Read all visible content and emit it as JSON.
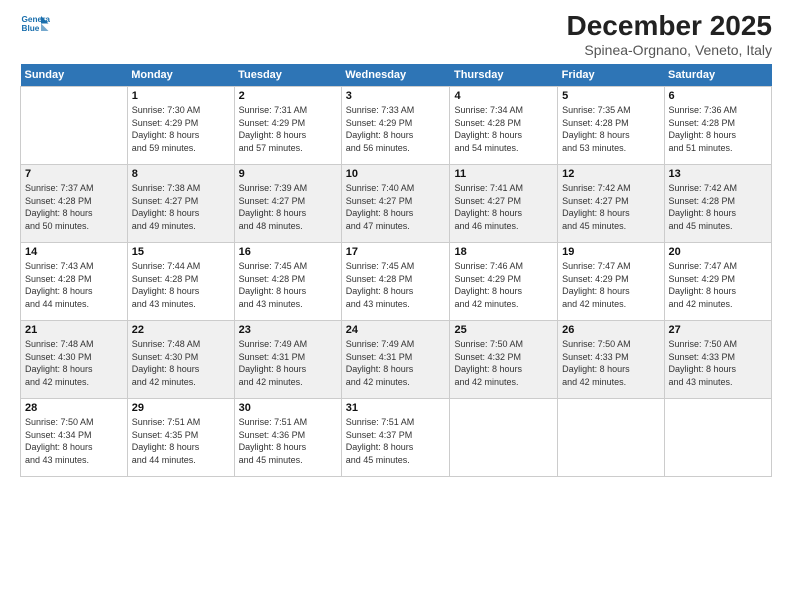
{
  "header": {
    "logo_line1": "General",
    "logo_line2": "Blue",
    "month": "December 2025",
    "location": "Spinea-Orgnano, Veneto, Italy"
  },
  "weekdays": [
    "Sunday",
    "Monday",
    "Tuesday",
    "Wednesday",
    "Thursday",
    "Friday",
    "Saturday"
  ],
  "weeks": [
    [
      {
        "day": "",
        "info": ""
      },
      {
        "day": "1",
        "info": "Sunrise: 7:30 AM\nSunset: 4:29 PM\nDaylight: 8 hours\nand 59 minutes."
      },
      {
        "day": "2",
        "info": "Sunrise: 7:31 AM\nSunset: 4:29 PM\nDaylight: 8 hours\nand 57 minutes."
      },
      {
        "day": "3",
        "info": "Sunrise: 7:33 AM\nSunset: 4:29 PM\nDaylight: 8 hours\nand 56 minutes."
      },
      {
        "day": "4",
        "info": "Sunrise: 7:34 AM\nSunset: 4:28 PM\nDaylight: 8 hours\nand 54 minutes."
      },
      {
        "day": "5",
        "info": "Sunrise: 7:35 AM\nSunset: 4:28 PM\nDaylight: 8 hours\nand 53 minutes."
      },
      {
        "day": "6",
        "info": "Sunrise: 7:36 AM\nSunset: 4:28 PM\nDaylight: 8 hours\nand 51 minutes."
      }
    ],
    [
      {
        "day": "7",
        "info": "Sunrise: 7:37 AM\nSunset: 4:28 PM\nDaylight: 8 hours\nand 50 minutes."
      },
      {
        "day": "8",
        "info": "Sunrise: 7:38 AM\nSunset: 4:27 PM\nDaylight: 8 hours\nand 49 minutes."
      },
      {
        "day": "9",
        "info": "Sunrise: 7:39 AM\nSunset: 4:27 PM\nDaylight: 8 hours\nand 48 minutes."
      },
      {
        "day": "10",
        "info": "Sunrise: 7:40 AM\nSunset: 4:27 PM\nDaylight: 8 hours\nand 47 minutes."
      },
      {
        "day": "11",
        "info": "Sunrise: 7:41 AM\nSunset: 4:27 PM\nDaylight: 8 hours\nand 46 minutes."
      },
      {
        "day": "12",
        "info": "Sunrise: 7:42 AM\nSunset: 4:27 PM\nDaylight: 8 hours\nand 45 minutes."
      },
      {
        "day": "13",
        "info": "Sunrise: 7:42 AM\nSunset: 4:28 PM\nDaylight: 8 hours\nand 45 minutes."
      }
    ],
    [
      {
        "day": "14",
        "info": "Sunrise: 7:43 AM\nSunset: 4:28 PM\nDaylight: 8 hours\nand 44 minutes."
      },
      {
        "day": "15",
        "info": "Sunrise: 7:44 AM\nSunset: 4:28 PM\nDaylight: 8 hours\nand 43 minutes."
      },
      {
        "day": "16",
        "info": "Sunrise: 7:45 AM\nSunset: 4:28 PM\nDaylight: 8 hours\nand 43 minutes."
      },
      {
        "day": "17",
        "info": "Sunrise: 7:45 AM\nSunset: 4:28 PM\nDaylight: 8 hours\nand 43 minutes."
      },
      {
        "day": "18",
        "info": "Sunrise: 7:46 AM\nSunset: 4:29 PM\nDaylight: 8 hours\nand 42 minutes."
      },
      {
        "day": "19",
        "info": "Sunrise: 7:47 AM\nSunset: 4:29 PM\nDaylight: 8 hours\nand 42 minutes."
      },
      {
        "day": "20",
        "info": "Sunrise: 7:47 AM\nSunset: 4:29 PM\nDaylight: 8 hours\nand 42 minutes."
      }
    ],
    [
      {
        "day": "21",
        "info": "Sunrise: 7:48 AM\nSunset: 4:30 PM\nDaylight: 8 hours\nand 42 minutes."
      },
      {
        "day": "22",
        "info": "Sunrise: 7:48 AM\nSunset: 4:30 PM\nDaylight: 8 hours\nand 42 minutes."
      },
      {
        "day": "23",
        "info": "Sunrise: 7:49 AM\nSunset: 4:31 PM\nDaylight: 8 hours\nand 42 minutes."
      },
      {
        "day": "24",
        "info": "Sunrise: 7:49 AM\nSunset: 4:31 PM\nDaylight: 8 hours\nand 42 minutes."
      },
      {
        "day": "25",
        "info": "Sunrise: 7:50 AM\nSunset: 4:32 PM\nDaylight: 8 hours\nand 42 minutes."
      },
      {
        "day": "26",
        "info": "Sunrise: 7:50 AM\nSunset: 4:33 PM\nDaylight: 8 hours\nand 42 minutes."
      },
      {
        "day": "27",
        "info": "Sunrise: 7:50 AM\nSunset: 4:33 PM\nDaylight: 8 hours\nand 43 minutes."
      }
    ],
    [
      {
        "day": "28",
        "info": "Sunrise: 7:50 AM\nSunset: 4:34 PM\nDaylight: 8 hours\nand 43 minutes."
      },
      {
        "day": "29",
        "info": "Sunrise: 7:51 AM\nSunset: 4:35 PM\nDaylight: 8 hours\nand 44 minutes."
      },
      {
        "day": "30",
        "info": "Sunrise: 7:51 AM\nSunset: 4:36 PM\nDaylight: 8 hours\nand 45 minutes."
      },
      {
        "day": "31",
        "info": "Sunrise: 7:51 AM\nSunset: 4:37 PM\nDaylight: 8 hours\nand 45 minutes."
      },
      {
        "day": "",
        "info": ""
      },
      {
        "day": "",
        "info": ""
      },
      {
        "day": "",
        "info": ""
      }
    ]
  ]
}
